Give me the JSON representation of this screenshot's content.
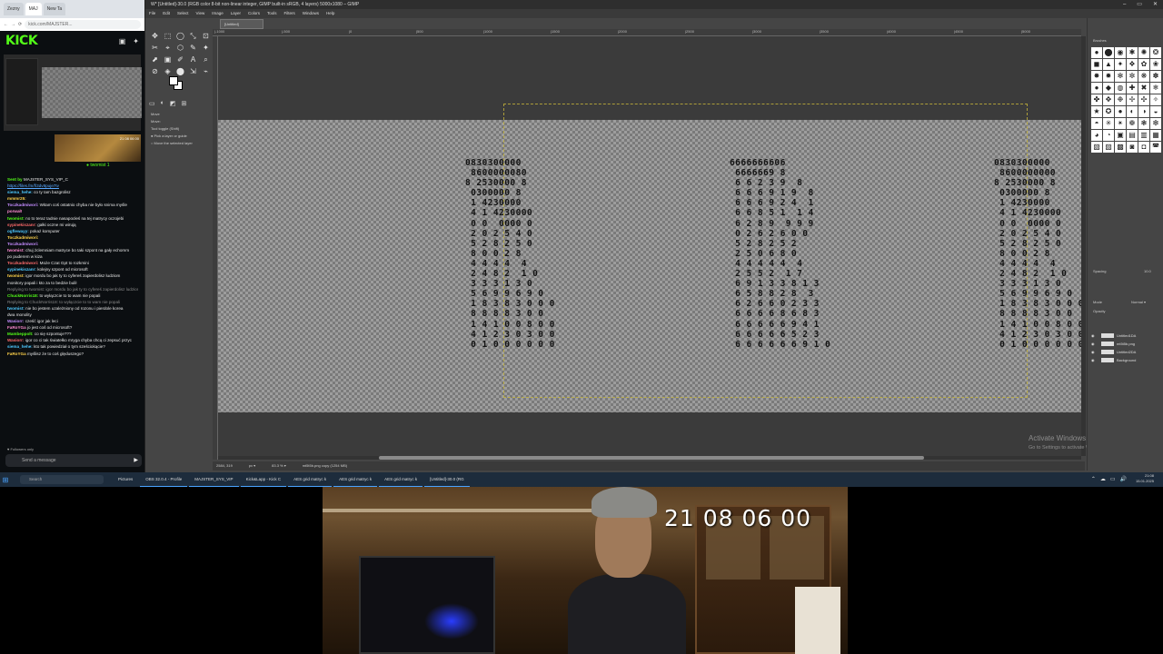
{
  "browser": {
    "tabs": [
      "Zezny",
      "MAJ",
      "New Ta"
    ],
    "url": "kick.com/MAJSTER...",
    "logo": "KICK",
    "streamer_tag": "● twomist 1"
  },
  "chat": {
    "messages": [
      {
        "kind": "user",
        "user": "Sent by",
        "text": "MAJSTER_SYS_VIP_C"
      },
      {
        "kind": "link",
        "user": "",
        "text": "https://files.fm/f/3dv8puje7tv"
      },
      {
        "kind": "user",
        "user": "siema_hehe:",
        "text": "co ty tam bazgrolisz"
      },
      {
        "kind": "user",
        "user": "mmmr25:",
        "text": ""
      },
      {
        "kind": "user",
        "user": "Toczkadmiwori:",
        "text": "Witam coś ostatnio chyba nie było snima myśle"
      },
      {
        "kind": "user",
        "user": "porwał!",
        "text": ""
      },
      {
        "kind": "user",
        "user": "twomist:",
        "text": "no to teraz tadnie nasapocłeś na tej matrycy oczojebi"
      },
      {
        "kind": "user",
        "user": "sypinekiszanr:",
        "text": "gałki oczne mi wirują"
      },
      {
        "kind": "user",
        "user": "ogflewayy:",
        "text": "pokaż komputer"
      },
      {
        "kind": "user",
        "user": "Toczkadmiwori:",
        "text": ""
      },
      {
        "kind": "user",
        "user": "Toczkadmiwori:",
        "text": ""
      },
      {
        "kind": "user",
        "user": "twomist:",
        "text": "chuj żclemniam matryce bo taki szpont na gały echomm"
      },
      {
        "kind": "user",
        "user": "",
        "text": "po puderem w kiza"
      },
      {
        "kind": "user",
        "user": "Toczkadmiwori:",
        "text": "Może Czat Gpt to rozkmini"
      },
      {
        "kind": "user",
        "user": "sypinekiszanr:",
        "text": "kolejny szpont od microsoft"
      },
      {
        "kind": "user",
        "user": "twomist:",
        "text": "igor mordu bo jak ty to cyfereś zapierdolisz ludziom"
      },
      {
        "kind": "user",
        "user": "",
        "text": "monitory popali i kto za to bedzie bulił"
      },
      {
        "kind": "reply",
        "user": "",
        "text": "Replying to twomist: igor mordu bo jak ty to cyfereś zapierdolisz ludziom"
      },
      {
        "kind": "user",
        "user": "ChuckNorris18:",
        "text": "to wyłączcie to to wam nie popali"
      },
      {
        "kind": "reply",
        "user": "",
        "text": "Replying to ChuckNorris18: to wyłączcie to to wam nie popali"
      },
      {
        "kind": "user",
        "user": "twomist:",
        "text": "nie bo jestem uzależniony od rozonu i pierdole korea"
      },
      {
        "kind": "user",
        "user": "",
        "text": "dwa monolity"
      },
      {
        "kind": "user",
        "user": "Wasiorr:",
        "text": "cześć igor jak leci"
      },
      {
        "kind": "user",
        "user": "FaRoYGa",
        "text": "jo jest coś od microsoft?"
      },
      {
        "kind": "user",
        "user": "Mambeppolt:",
        "text": "co się szpontuje???"
      },
      {
        "kind": "user",
        "user": "Wasiorr:",
        "text": "igor co ci tak światełko mryga chyba chcą ci zepsuć przyc"
      },
      {
        "kind": "user",
        "user": "siema_hehe:",
        "text": "kto tak powiedział o tym sześciokącie?"
      },
      {
        "kind": "user",
        "user": "FaRoYGa",
        "text": "myślisz że to coś ględuszego?"
      }
    ],
    "followers_note": "♥ Followers only",
    "input_placeholder": "Send a message",
    "send_icon": "▶"
  },
  "gimp": {
    "title": "W* [Untitled]-30.0 (RGB color 8-bit non-linear integer, GIMP built-in sRGB, 4 layers) 5000x1080 – GIMP",
    "menu": [
      "File",
      "Edit",
      "Select",
      "View",
      "Image",
      "Layer",
      "Colors",
      "Tools",
      "Filters",
      "Windows",
      "Help"
    ],
    "image_tab": "[Untitled]",
    "tools": [
      "✥",
      "⬚",
      "◯",
      "⤡",
      "⊡",
      "✂",
      "⌖",
      "⬡",
      "✎",
      "✦",
      "⬈",
      "▣",
      "✐",
      "A",
      "⌕",
      "⊘",
      "◈",
      "⬤",
      "⇲",
      "⌁"
    ],
    "tool_options": {
      "tabs": [
        "▭",
        "◐",
        "◩",
        "⊞"
      ],
      "lines": [
        "Move",
        "Move:",
        "Tool toggle (Shift)",
        "● Pick a layer or guide",
        "○ Move the selected layer"
      ]
    },
    "ruler_marks": [
      "|-1000",
      "|-500",
      "|0",
      "|500",
      "|1000",
      "|1500",
      "|2000",
      "|2500",
      "|3000",
      "|3500",
      "|4000",
      "|4500",
      "|5000",
      "|5500"
    ],
    "digit_blocks": [
      {
        "text": "0830300000\n 8600000080\n8 2530000 8\n 0300000 8\n 1 4230000\n 4 1 4230000\n 0 0  0000 0\n 2 0 2 5 4 0\n 5 2 8 2 5 0\n 8 0 0 2 8\n 4 4 4 4  4\n 2 4 8 2  1 0\n 3 3 3 1 3 0\n 5 6 9 9 6 9 0\n 1 8 3 8 3 0 0 0\n 8 8 8 8 3 0 0\n 1 4 1 0 0 8 0 0\n 4 1 2 3 0 3 0 0\n 0 1 0 0 0 0 0 0"
      },
      {
        "text": "6666666606\n 6666669 8\n 6 6 2 3 9  8\n 6 6 6 9 1 9  8\n 6 6 6 9 2 4  1\n 6 6 8 5 1  1 4\n 6 2 8 9  9 9 9\n 0 2 6 2 6 0 0\n 5 2 8 2 5 2\n 2 5 0 6 8 0\n 4 4 4 4 4  4\n 2 5 5 2  1 7\n 6 9 1 3 3 8 1 3\n 6 5 8 8 2 8  3\n 6 2 6 6 0 2 3 3\n 6 6 6 6 8 6 8 3\n 6 6 6 6 6 9 4 1\n 6 6 6 6 6 5 2 3\n 6 6 6 6 6 6 9 1 0"
      },
      {
        "text": "0830300000\n 8600000000\n8 2530000 8\n 0300000 8\n 1 4230000\n 4 1 4230000\n 0 0  0000 0\n 2 0 2 5 4 0\n 5 2 8 2 5 0\n 8 0 0 2 8\n 4 4 4 4  4\n 2 4 8 2  1 0\n 3 3 3 1 3 0\n 5 6 9 9 6 9 0\n 1 8 3 8 3 0 0 0\n 8 8 8 8 3 0 0\n 1 4 1 0 0 8 0 0\n 4 1 2 3 0 3 0 0\n 0 1 0 0 0 0 0 0"
      }
    ],
    "status": [
      "2584, 319",
      "px ▾",
      "83.3 % ▾",
      "mt5t5b.png copy (1254 MB)"
    ],
    "watermark_title": "Activate Windows",
    "watermark_sub": "Go to Settings to activate Windows.",
    "dock": {
      "brushes_label": "Brushes",
      "spacing_label": "Spacing",
      "spacing_value": "10.0",
      "mode_label": "Mode",
      "mode_value": "Normal ▾",
      "opacity_label": "Opacity",
      "layers": [
        "Untitled1DA",
        "mt5t5b.png",
        "Untitled2DA",
        "Background"
      ]
    }
  },
  "taskbar": {
    "start_icon": "⊞",
    "search_placeholder": "Search",
    "items": [
      "Pictures",
      "OBS 32.0.4 - Profile",
      "MAJSTER_SYS_VIP",
      "Kick&Lapp - Kick C",
      "AES grid matryc k",
      "AES grid matryc k",
      "AES grid matryc k",
      "[Untitled]-30.0 (RG"
    ],
    "tray_icons": [
      "⌃",
      "☁",
      "▭",
      "🔊"
    ],
    "time": "21:08",
    "date": "15.01.2025"
  },
  "webcam": {
    "timecode": "21 08 06 00"
  }
}
